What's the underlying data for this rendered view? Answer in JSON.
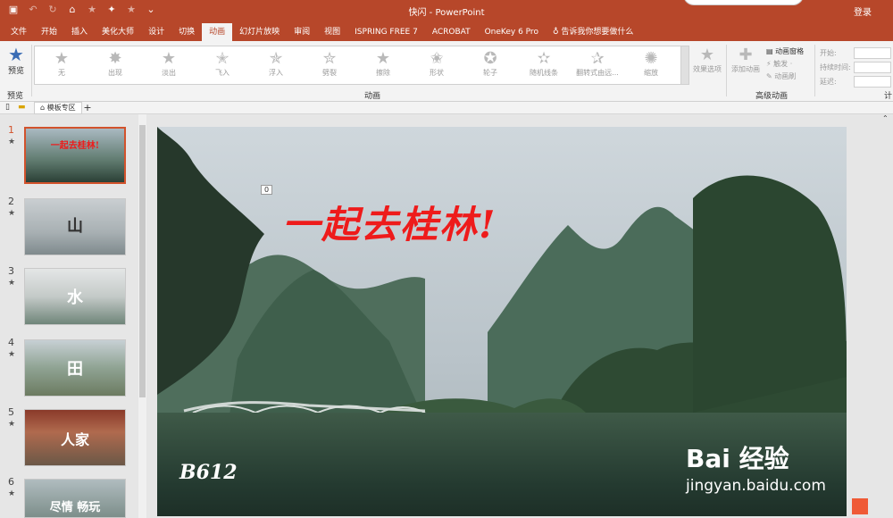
{
  "titlebar": {
    "title": "快闪 - PowerPoint",
    "login": "登录",
    "qat_icons": [
      "save-icon",
      "undo-icon",
      "redo-icon",
      "format-painter-icon",
      "star-icon",
      "effect-icon",
      "star-icon",
      "more-icon"
    ]
  },
  "tabs": [
    "文件",
    "开始",
    "插入",
    "美化大师",
    "设计",
    "切换",
    "动画",
    "幻灯片放映",
    "审阅",
    "视图",
    "ISPRING FREE 7",
    "ACROBAT",
    "OneKey 6 Pro"
  ],
  "active_tab": "动画",
  "tellme": "告诉我你想要做什么",
  "ribbon": {
    "preview": "预览",
    "preview_group": "预览",
    "animations": [
      "无",
      "出现",
      "淡出",
      "飞入",
      "浮入",
      "劈裂",
      "擦除",
      "形状",
      "轮子",
      "随机线条",
      "翻转式由远...",
      "缩放"
    ],
    "animation_group": "动画",
    "effect_options": "效果选项",
    "add_animation": "添加动画",
    "advanced": [
      "动画窗格",
      "触发 ·",
      "动画刷"
    ],
    "advanced_group": "高级动画",
    "timing": {
      "start": "开始:",
      "duration": "持续时间:",
      "delay": "延迟:"
    },
    "timing_group": "计"
  },
  "sectionbar": {
    "tab": "模板专区",
    "plus": "+"
  },
  "slides": [
    {
      "num": "1",
      "caption": "一起去桂林!"
    },
    {
      "num": "2",
      "caption": "山"
    },
    {
      "num": "3",
      "caption": "水"
    },
    {
      "num": "4",
      "caption": "田"
    },
    {
      "num": "5",
      "caption": "人家"
    },
    {
      "num": "6",
      "caption": "尽情 畅玩"
    }
  ],
  "canvas": {
    "headline": "一起去桂林!",
    "anim_tag": "0",
    "b612": "B612",
    "wm_bai": "Bai 经验",
    "wm_url": "jingyan.baidu.com"
  },
  "colors": {
    "titlebar": "#b7472a",
    "selection": "#d2522c",
    "headline": "#ee1b1b"
  }
}
